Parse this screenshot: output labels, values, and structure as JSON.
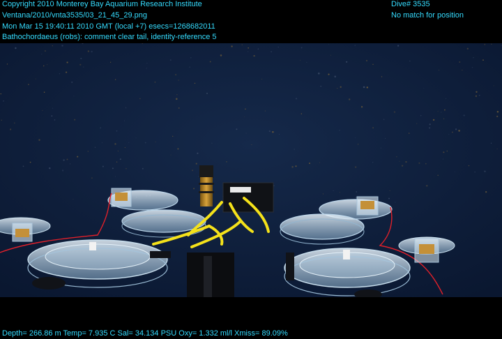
{
  "overlay": {
    "copyright": "Copyright 2010 Monterey Bay Aquarium Research Institute",
    "file_path": "Ventana/2010/vnta3535/03_21_45_29.png",
    "timestamp": "Mon Mar 15 19:40:11 2010 GMT (local +7)  esecs=1268682011",
    "annotation": "Bathochordaeus (robs): comment clear tail, identity-reference 5",
    "dive": "Dive# 3535",
    "position_status": "No match for position",
    "sensors": "Depth= 266.86 m  Temp= 7.935 C  Sal= 34.134 PSU  Oxy= 1.332 ml/l  Xmiss= 89.09%"
  },
  "colors": {
    "overlay_text": "#35dcff",
    "water": "#0d1e3a",
    "yellow_rope": "#f5e21a",
    "red_cable": "#e0202a",
    "acrylic": "#cfe6f3"
  },
  "scene": {
    "subject": "ROV sampler carousel with clear acrylic canisters in midwater"
  }
}
